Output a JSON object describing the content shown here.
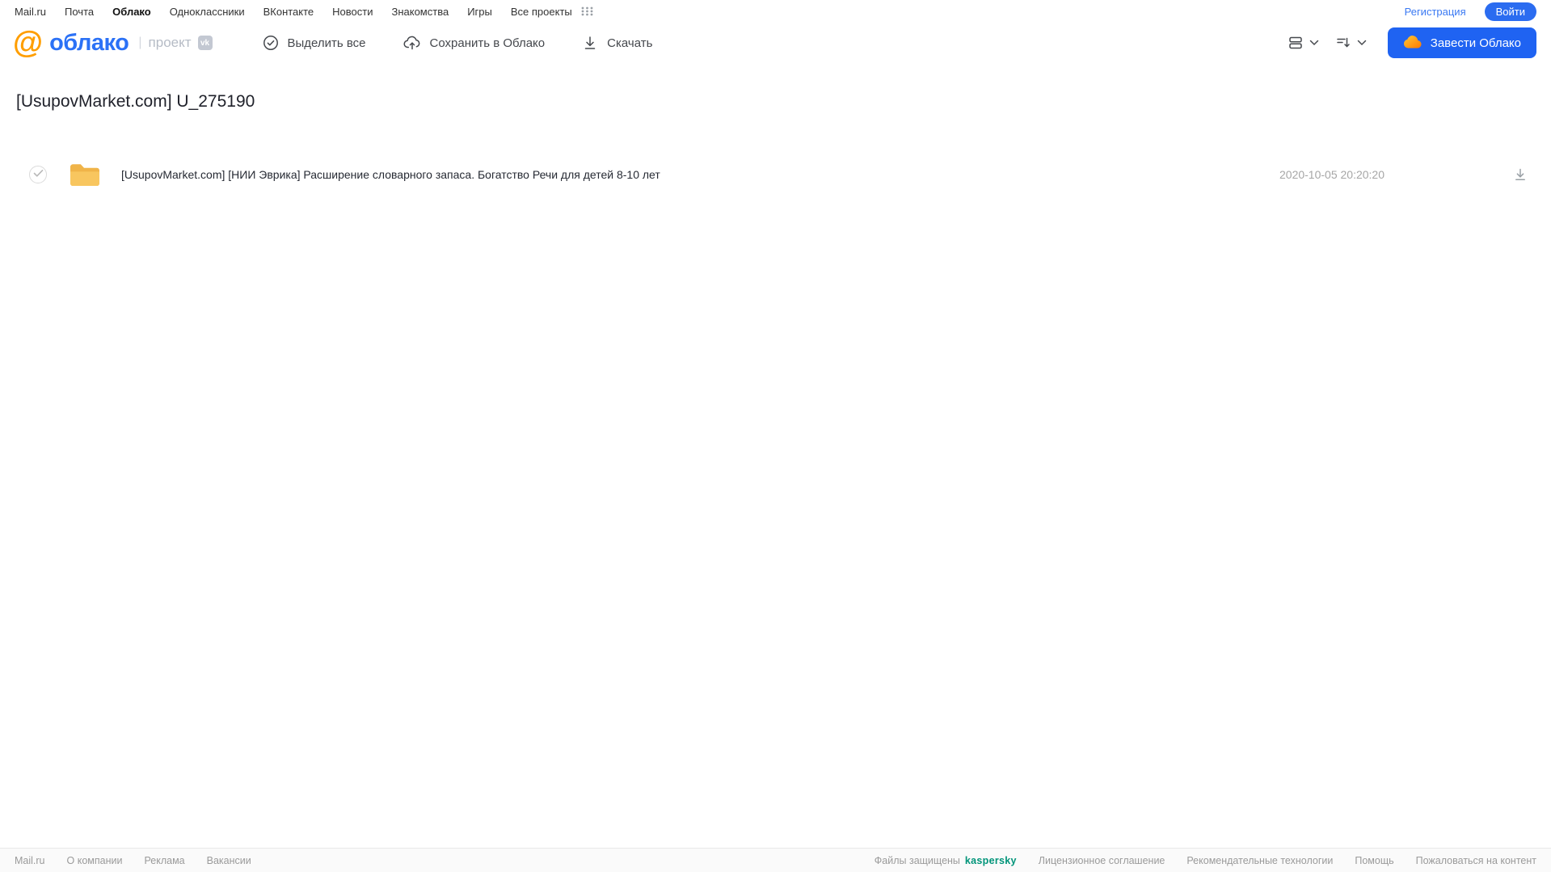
{
  "top_bar": {
    "links": [
      "Mail.ru",
      "Почта",
      "Облако",
      "Одноклассники",
      "ВКонтакте",
      "Новости",
      "Знакомства",
      "Игры",
      "Все проекты"
    ],
    "active_link": "Облако",
    "registration_label": "Регистрация",
    "login_label": "Войти"
  },
  "header": {
    "logo_at": "@",
    "logo_text": "облако",
    "project_label": "проект",
    "vk_badge": "vk",
    "toolbar": [
      {
        "label": "Выделить все",
        "icon": "check-circle-icon"
      },
      {
        "label": "Сохранить в Облако",
        "icon": "cloud-upload-icon"
      },
      {
        "label": "Скачать",
        "icon": "download-icon"
      }
    ],
    "view_controls": [
      "view-mode-icon",
      "sort-icon"
    ],
    "create_cloud_label": "Завести Облако",
    "create_cloud_icon": "cloud-icon"
  },
  "main": {
    "title": "[UsupovMarket.com] U_275190",
    "files": [
      {
        "type": "folder",
        "checked": true,
        "name": "[UsupovMarket.com] [НИИ Эврика] Расширение словарного запаса. Богатство Речи для детей 8-10 лет",
        "date": "2020-10-05 20:20:20",
        "download_icon": "download-icon"
      }
    ]
  },
  "footer": {
    "left_links": [
      "Mail.ru",
      "О компании",
      "Реклама",
      "Вакансии"
    ],
    "protected_text": "Файлы защищены",
    "kaspersky_label": "kaspersky",
    "right_links": [
      "Лицензионное соглашение",
      "Рекомендательные технологии",
      "Помощь",
      "Пожаловаться на контент"
    ]
  },
  "colors": {
    "accent_blue": "#1f63f2",
    "link_blue": "#3a79f3",
    "logo_orange": "#ff9e00",
    "logo_blue": "#2b71f6",
    "folder_yellow": "#f6be4e",
    "kaspersky_green": "#009479",
    "muted_gray": "#9a9a9a"
  }
}
